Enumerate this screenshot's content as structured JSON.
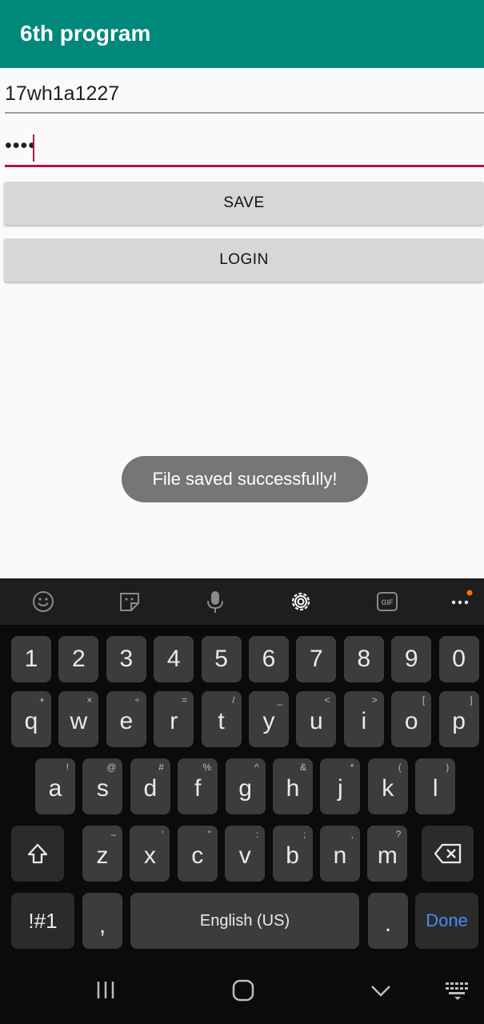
{
  "app": {
    "title": "6th program"
  },
  "form": {
    "username_value": "17wh1a1227",
    "password_value": "••••",
    "save_label": "SAVE",
    "login_label": "LOGIN"
  },
  "toast": {
    "message": "File saved successfully!"
  },
  "keyboard": {
    "row_numbers": [
      "1",
      "2",
      "3",
      "4",
      "5",
      "6",
      "7",
      "8",
      "9",
      "0"
    ],
    "row_q": [
      {
        "k": "q",
        "h": "+"
      },
      {
        "k": "w",
        "h": "×"
      },
      {
        "k": "e",
        "h": "÷"
      },
      {
        "k": "r",
        "h": "="
      },
      {
        "k": "t",
        "h": "/"
      },
      {
        "k": "y",
        "h": "_"
      },
      {
        "k": "u",
        "h": "<"
      },
      {
        "k": "i",
        "h": ">"
      },
      {
        "k": "o",
        "h": "["
      },
      {
        "k": "p",
        "h": "]"
      }
    ],
    "row_a": [
      {
        "k": "a",
        "h": "!"
      },
      {
        "k": "s",
        "h": "@"
      },
      {
        "k": "d",
        "h": "#"
      },
      {
        "k": "f",
        "h": "%"
      },
      {
        "k": "g",
        "h": "^"
      },
      {
        "k": "h",
        "h": "&"
      },
      {
        "k": "j",
        "h": "*"
      },
      {
        "k": "k",
        "h": "("
      },
      {
        "k": "l",
        "h": ")"
      }
    ],
    "row_z": [
      {
        "k": "z",
        "h": "–"
      },
      {
        "k": "x",
        "h": "'"
      },
      {
        "k": "c",
        "h": "\""
      },
      {
        "k": "v",
        "h": ":"
      },
      {
        "k": "b",
        "h": ";"
      },
      {
        "k": "n",
        "h": ","
      },
      {
        "k": "m",
        "h": "?"
      }
    ],
    "symbols_label": "!#1",
    "comma_label": ",",
    "space_label": "English (US)",
    "period_label": ".",
    "done_label": "Done",
    "accent_color": "#4a8af4"
  },
  "icons": {
    "toolbar": [
      "emoji-icon",
      "sticker-icon",
      "mic-icon",
      "settings-icon",
      "gif-icon",
      "more-icon"
    ],
    "nav": [
      "recents-icon",
      "home-icon",
      "back-icon",
      "keyboard-icon"
    ]
  }
}
